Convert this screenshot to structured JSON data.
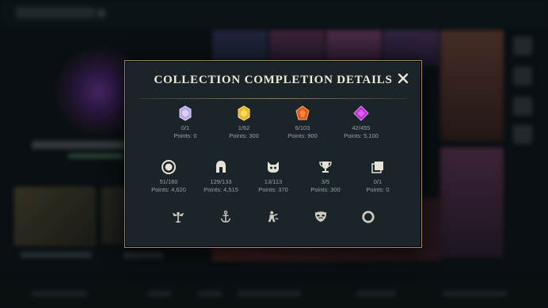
{
  "modal": {
    "title": "COLLECTION COMPLETION DETAILS",
    "close_label": "✕"
  },
  "row1": [
    {
      "icon": "common-gem-icon",
      "color": "#c7b6ee",
      "count": "0/1",
      "points": "Points: 0"
    },
    {
      "icon": "gold-gem-icon",
      "color": "#f1c83a",
      "count": "1/62",
      "points": "Points: 300"
    },
    {
      "icon": "orange-gem-icon",
      "color": "#ec6a26",
      "count": "6/103",
      "points": "Points: 900"
    },
    {
      "icon": "purple-gem-icon",
      "color": "#c23ed6",
      "count": "42/455",
      "points": "Points: 5,100"
    }
  ],
  "row2": [
    {
      "icon": "icon-ring-icon",
      "count": "51/160",
      "points": "Points: 4,620"
    },
    {
      "icon": "helmet-icon",
      "count": "129/133",
      "points": "Points: 4,515"
    },
    {
      "icon": "cat-head-icon",
      "count": "13/113",
      "points": "Points: 370"
    },
    {
      "icon": "trophy-icon",
      "count": "3/5",
      "points": "Points: 300"
    },
    {
      "icon": "cards-stack-icon",
      "count": "0/1",
      "points": "Points: 0"
    }
  ],
  "row3": [
    {
      "icon": "winged-emblem-icon"
    },
    {
      "icon": "anchor-icon"
    },
    {
      "icon": "emote-figure-icon"
    },
    {
      "icon": "mask-icon"
    },
    {
      "icon": "ring-border-icon"
    }
  ],
  "colors": {
    "modal_bg": "#1b2428",
    "border_gold": "#a48a52",
    "title_text": "#efe9d8",
    "stat_text": "#9aa2a4"
  }
}
